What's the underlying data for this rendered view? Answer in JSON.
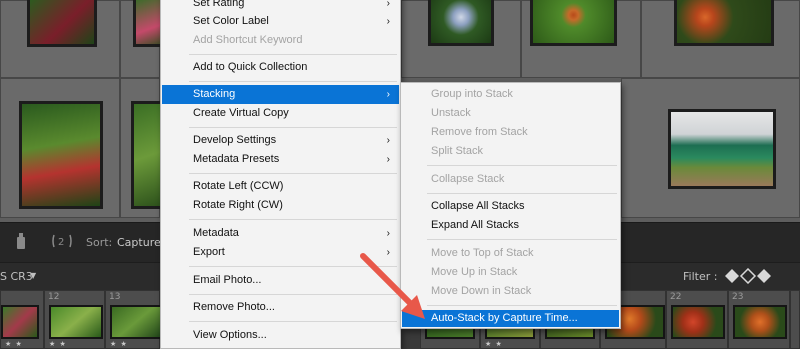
{
  "toolbar": {
    "sort_label": "Sort:",
    "sort_value": "Capture T"
  },
  "filterbar": {
    "source_label": "S CR3",
    "filter_label": "Filter :"
  },
  "filmstrip": {
    "numbers": [
      "",
      "12",
      "13",
      "",
      "",
      "",
      "",
      "",
      "",
      "",
      "",
      "22",
      "23",
      ""
    ],
    "stars": "★ ★"
  },
  "context_menu": {
    "items": [
      {
        "label": "Set Rating",
        "arrow": true
      },
      {
        "label": "Set Color Label",
        "arrow": true
      },
      {
        "label": "Add Shortcut Keyword",
        "disabled": true
      },
      {
        "label": "Add to Quick Collection"
      },
      {
        "label": "Stacking",
        "arrow": true,
        "selected": true
      },
      {
        "label": "Create Virtual Copy"
      },
      {
        "label": "Develop Settings",
        "arrow": true
      },
      {
        "label": "Metadata Presets",
        "arrow": true
      },
      {
        "label": "Rotate Left (CCW)"
      },
      {
        "label": "Rotate Right (CW)"
      },
      {
        "label": "Metadata",
        "arrow": true
      },
      {
        "label": "Export",
        "arrow": true
      },
      {
        "label": "Email Photo..."
      },
      {
        "label": "Remove Photo..."
      },
      {
        "label": "View Options..."
      }
    ]
  },
  "stacking_submenu": {
    "items": [
      {
        "label": "Group into Stack",
        "disabled": true
      },
      {
        "label": "Unstack",
        "disabled": true
      },
      {
        "label": "Remove from Stack",
        "disabled": true
      },
      {
        "label": "Split Stack",
        "disabled": true
      },
      {
        "label": "Collapse Stack",
        "disabled": true
      },
      {
        "label": "Collapse All Stacks"
      },
      {
        "label": "Expand All Stacks"
      },
      {
        "label": "Move to Top of Stack",
        "disabled": true
      },
      {
        "label": "Move Up in Stack",
        "disabled": true
      },
      {
        "label": "Move Down in Stack",
        "disabled": true
      },
      {
        "label": "Auto-Stack by Capture Time...",
        "selected": true
      }
    ]
  },
  "colors": {
    "menu_highlight": "#0a74d6",
    "annotation_arrow": "#e8584a"
  }
}
